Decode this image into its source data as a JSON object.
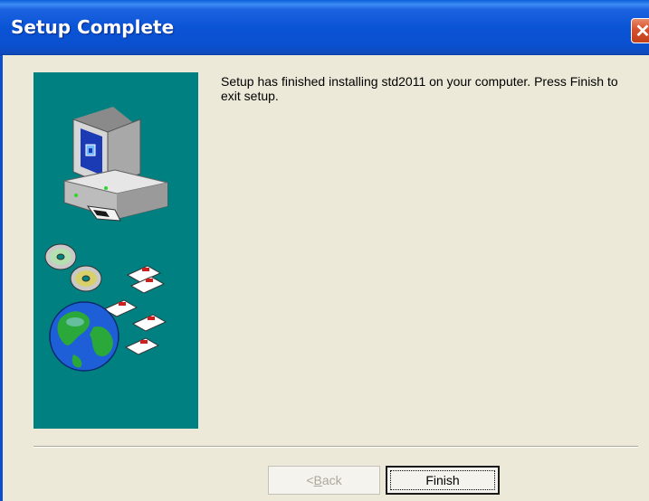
{
  "window": {
    "title": "Setup Complete",
    "close_glyph": "✕"
  },
  "content": {
    "message": "Setup has finished installing std2011 on your computer. Press Finish to exit setup."
  },
  "buttons": {
    "back_prefix": "< ",
    "back_accel": "B",
    "back_rest": "ack",
    "finish_label": "Finish"
  },
  "colors": {
    "titlebar": "#0a54d6",
    "banner": "#008080",
    "background": "#ece9d8"
  },
  "icons": [
    "computer-icon",
    "cd-discs-icon",
    "floppy-disks-icon",
    "globe-icon",
    "close-icon"
  ]
}
